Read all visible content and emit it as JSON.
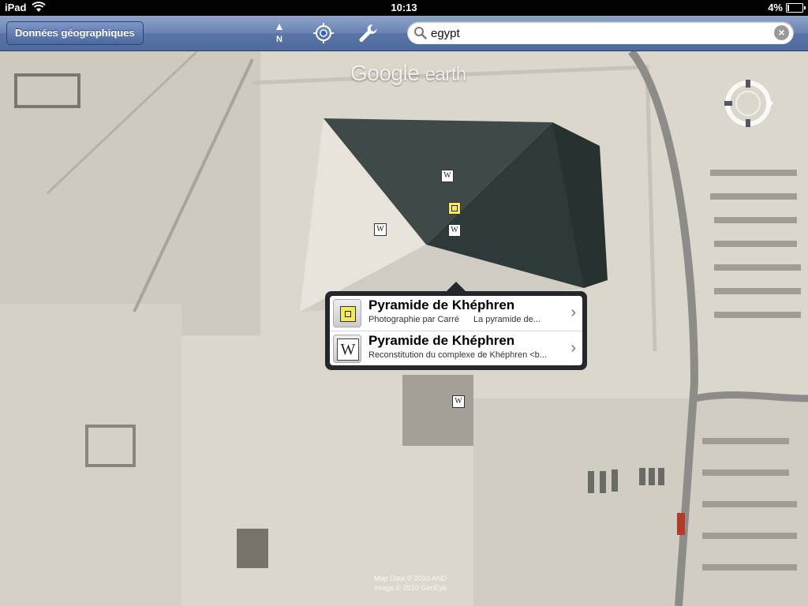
{
  "status_bar": {
    "carrier": "iPad",
    "time": "10:13",
    "battery": "4%"
  },
  "toolbar": {
    "data_button": "Données géographiques",
    "north_label": "N",
    "search": {
      "value": "egypt",
      "placeholder": ""
    }
  },
  "map": {
    "logo_main": "Google",
    "logo_sub": "earth",
    "copyright_line1": "Map Data © 2010 AND",
    "copyright_line2": "Image © 2010 GeoEye",
    "pins": [
      {
        "kind": "wiki",
        "glyph": "W"
      },
      {
        "kind": "photo",
        "glyph": ""
      },
      {
        "kind": "wiki",
        "glyph": "W"
      },
      {
        "kind": "wiki",
        "glyph": "W"
      },
      {
        "kind": "wiki",
        "glyph": "W"
      }
    ]
  },
  "popover": {
    "items": [
      {
        "icon": "photo-icon",
        "title": "Pyramide de Khéphren",
        "subtitle_left": "Photographie par Carré",
        "subtitle_right": "La pyramide de..."
      },
      {
        "icon": "wikipedia-icon",
        "title": "Pyramide de Khéphren",
        "subtitle_left": "Reconstitution du complexe de Khéphren <b...",
        "subtitle_right": ""
      }
    ]
  },
  "colors": {
    "toolbar": "#6a83b4",
    "pyramid_shadow": "#2e3a3a",
    "sand": "#d9d4c9"
  }
}
